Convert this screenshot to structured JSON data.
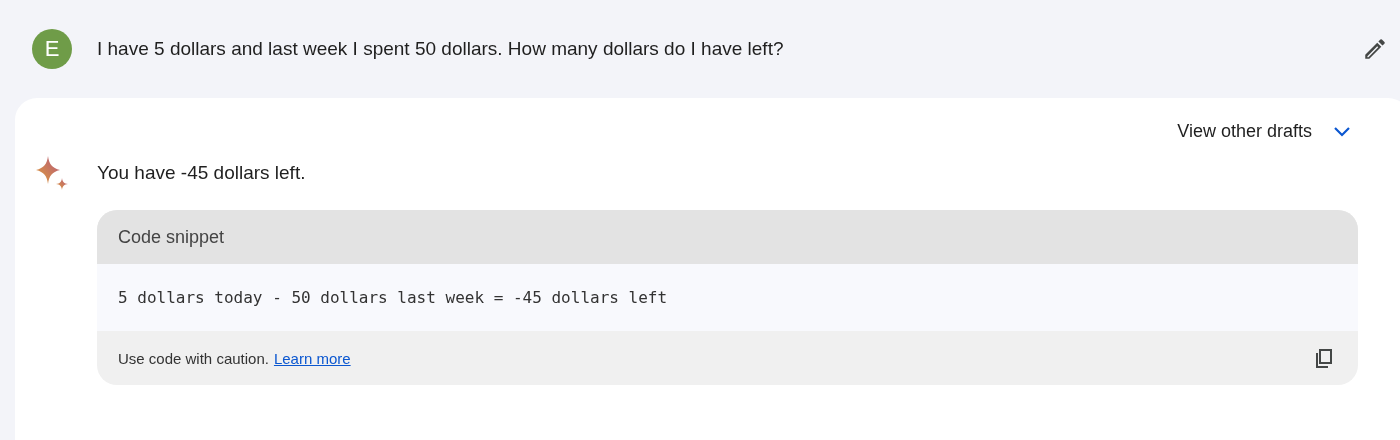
{
  "prompt": {
    "avatar": "E",
    "text": "I have 5 dollars and last week I spent 50 dollars. How many dollars do I have left?"
  },
  "response": {
    "drafts_label": "View other drafts",
    "text": "You have -45 dollars left.",
    "code_snippet": {
      "title": "Code snippet",
      "code": "5 dollars today - 50 dollars last week = -45 dollars left",
      "caution": "Use code with caution.",
      "link": "Learn more"
    }
  }
}
